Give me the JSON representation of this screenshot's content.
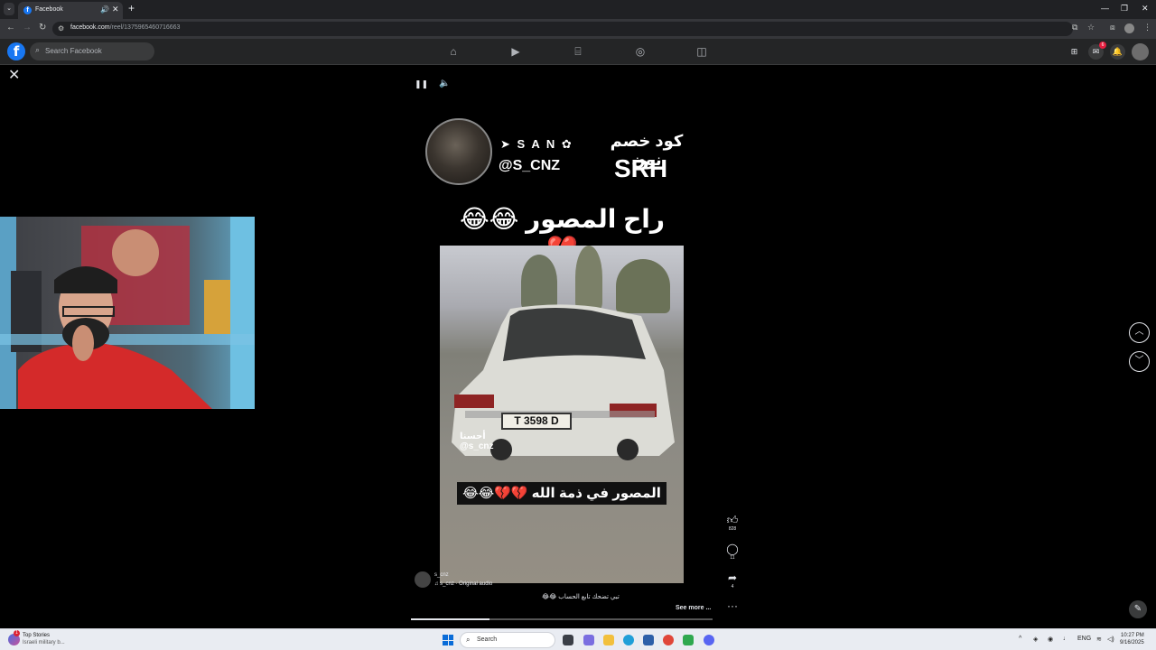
{
  "browser": {
    "tab_title": "Facebook",
    "url_domain": "facebook.com",
    "url_path": "/reel/1375965460716663"
  },
  "facebook": {
    "logo": "f",
    "search_placeholder": "Search Facebook",
    "notification_badge": "6",
    "nav_icons": [
      "home-icon",
      "video-icon",
      "marketplace-icon",
      "groups-icon",
      "gaming-icon"
    ]
  },
  "reel": {
    "overlay": {
      "san_label": "S A N",
      "handle": "@S_CNZ",
      "arabic_line1": "كود خصم نون",
      "srh": "SRH",
      "title_arabic": "راح المصور 😂😂💔"
    },
    "video": {
      "plate": "T 3598 D",
      "watermark_arabic": "أحسنا",
      "watermark_handle": "@s_cnz",
      "caption_arabic": "المصور في ذمة الله 💔💔😂😂"
    },
    "author_name": "s_cnz",
    "audio_label": "♫ s_cnz · Original audio",
    "description": "تبي تضحك تابع الحساب 😂😂",
    "see_more": "See more ...",
    "progress": 0.26,
    "actions": {
      "likes": "828",
      "comments": "11",
      "shares": "4"
    }
  },
  "taskbar": {
    "news_title": "Top Stories",
    "news_subtitle": "Israeli military b...",
    "news_badge": "1",
    "search_placeholder": "Search",
    "lang": "ENG",
    "time": "10:27 PM",
    "date": "9/16/2025"
  }
}
